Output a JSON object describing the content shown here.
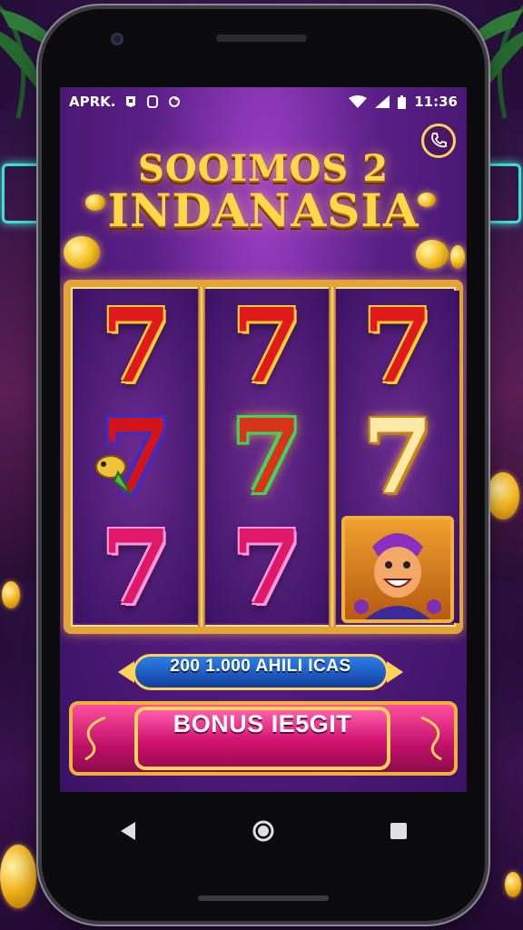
{
  "status_bar": {
    "carrier": "APRK.",
    "time": "11:36"
  },
  "game": {
    "title_line1": "SOOIMOS 2",
    "title_line2": "INDANASIA",
    "reels": [
      [
        "7",
        "7",
        "7"
      ],
      [
        "7",
        "7",
        "7"
      ],
      [
        "7",
        "7",
        ""
      ]
    ],
    "credits_label": "200 1.000 AHILI ICAS",
    "bonus_button_label": "BONUS IE5GIT"
  },
  "icons": {
    "status": [
      "notification-icon",
      "shield-icon",
      "sync-icon",
      "wifi-icon",
      "signal-icon",
      "battery-icon"
    ],
    "menu": "phone-icon",
    "nav": [
      "back-icon",
      "home-icon",
      "recents-icon"
    ]
  },
  "colors": {
    "gold": "#ffd35a",
    "purple": "#5a1f86",
    "pink": "#d0126e",
    "blue": "#2b7fe8"
  }
}
